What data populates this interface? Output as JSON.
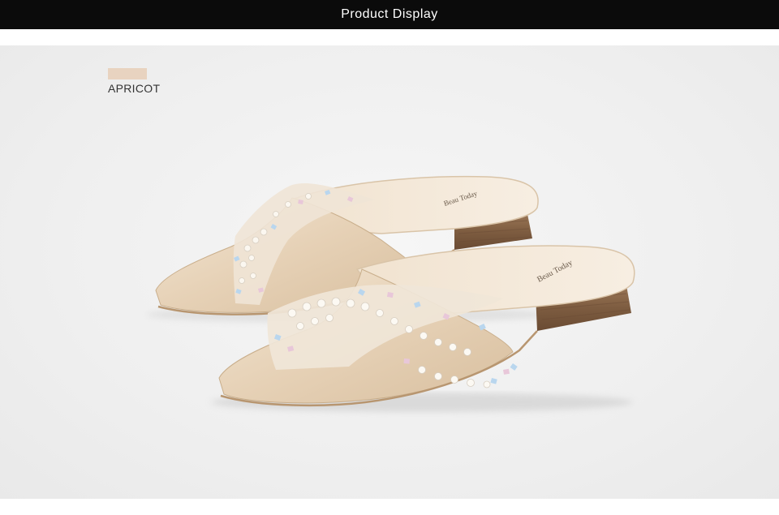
{
  "header": {
    "title": "Product Display"
  },
  "product": {
    "color_name": "APRICOT",
    "swatch_color": "#e8d3c0",
    "shoe_color": "#e9d6bd",
    "heel_color": "#8a6648",
    "brand_imprint": "Beau Today"
  }
}
